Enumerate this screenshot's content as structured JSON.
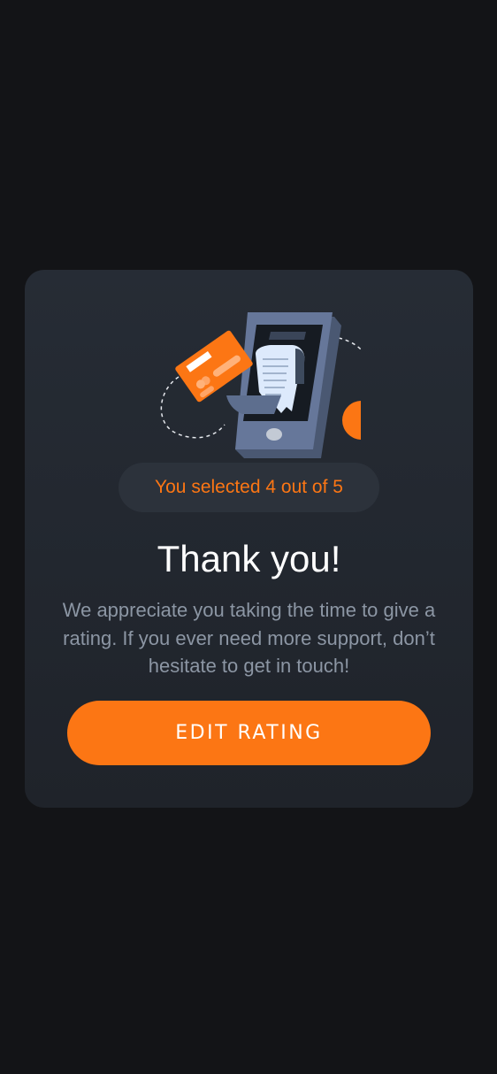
{
  "rating": {
    "badge_text": "You selected 4 out of 5",
    "value": 4,
    "max": 5
  },
  "thanks": {
    "title": "Thank you!",
    "message": "We appreciate you taking the time to give a rating. If you ever need more support, don’t hesitate to get in touch!"
  },
  "actions": {
    "edit_label": "EDIT RATING"
  },
  "colors": {
    "page_background": "#131417",
    "card_background": "#252a32",
    "accent": "#fc7614",
    "badge_background": "#2c323b",
    "message_text": "#8c96a4"
  },
  "icons": {
    "illustration": "phone-receipt-card-illustration"
  }
}
